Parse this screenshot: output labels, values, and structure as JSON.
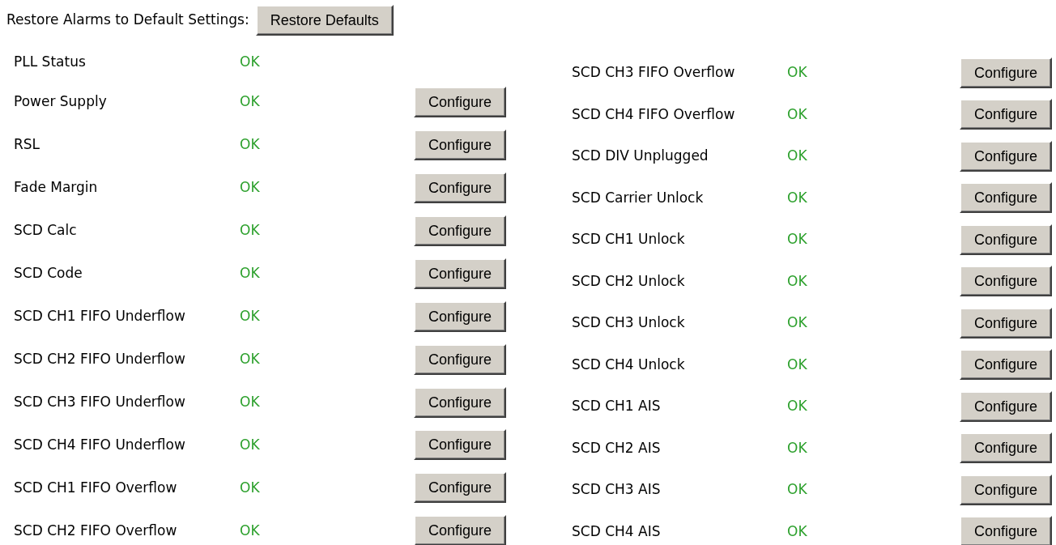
{
  "restore": {
    "label": "Restore Alarms to Default Settings:",
    "button": "Restore Defaults"
  },
  "left_alarms": [
    {
      "name": "PLL Status",
      "status": "OK",
      "configurable": false
    },
    {
      "name": "Power Supply",
      "status": "OK",
      "configurable": true,
      "button": "Configure"
    },
    {
      "name": "RSL",
      "status": "OK",
      "configurable": true,
      "button": "Configure"
    },
    {
      "name": "Fade Margin",
      "status": "OK",
      "configurable": true,
      "button": "Configure"
    },
    {
      "name": "SCD Calc",
      "status": "OK",
      "configurable": true,
      "button": "Configure"
    },
    {
      "name": "SCD Code",
      "status": "OK",
      "configurable": true,
      "button": "Configure"
    },
    {
      "name": "SCD CH1 FIFO Underflow",
      "status": "OK",
      "configurable": true,
      "button": "Configure"
    },
    {
      "name": "SCD CH2 FIFO Underflow",
      "status": "OK",
      "configurable": true,
      "button": "Configure"
    },
    {
      "name": "SCD CH3 FIFO Underflow",
      "status": "OK",
      "configurable": true,
      "button": "Configure"
    },
    {
      "name": "SCD CH4 FIFO Underflow",
      "status": "OK",
      "configurable": true,
      "button": "Configure"
    },
    {
      "name": "SCD CH1 FIFO Overflow",
      "status": "OK",
      "configurable": true,
      "button": "Configure"
    },
    {
      "name": "SCD CH2 FIFO Overflow",
      "status": "OK",
      "configurable": true,
      "button": "Configure"
    }
  ],
  "right_alarms": [
    {
      "name": "SCD CH3 FIFO Overflow",
      "status": "OK",
      "configurable": true,
      "button": "Configure"
    },
    {
      "name": "SCD CH4 FIFO Overflow",
      "status": "OK",
      "configurable": true,
      "button": "Configure"
    },
    {
      "name": "SCD DIV Unplugged",
      "status": "OK",
      "configurable": true,
      "button": "Configure"
    },
    {
      "name": "SCD Carrier Unlock",
      "status": "OK",
      "configurable": true,
      "button": "Configure"
    },
    {
      "name": "SCD CH1 Unlock",
      "status": "OK",
      "configurable": true,
      "button": "Configure"
    },
    {
      "name": "SCD CH2 Unlock",
      "status": "OK",
      "configurable": true,
      "button": "Configure"
    },
    {
      "name": "SCD CH3 Unlock",
      "status": "OK",
      "configurable": true,
      "button": "Configure"
    },
    {
      "name": "SCD CH4 Unlock",
      "status": "OK",
      "configurable": true,
      "button": "Configure"
    },
    {
      "name": "SCD CH1 AIS",
      "status": "OK",
      "configurable": true,
      "button": "Configure"
    },
    {
      "name": "SCD CH2 AIS",
      "status": "OK",
      "configurable": true,
      "button": "Configure"
    },
    {
      "name": "SCD CH3 AIS",
      "status": "OK",
      "configurable": true,
      "button": "Configure"
    },
    {
      "name": "SCD CH4 AIS",
      "status": "OK",
      "configurable": true,
      "button": "Configure"
    }
  ]
}
